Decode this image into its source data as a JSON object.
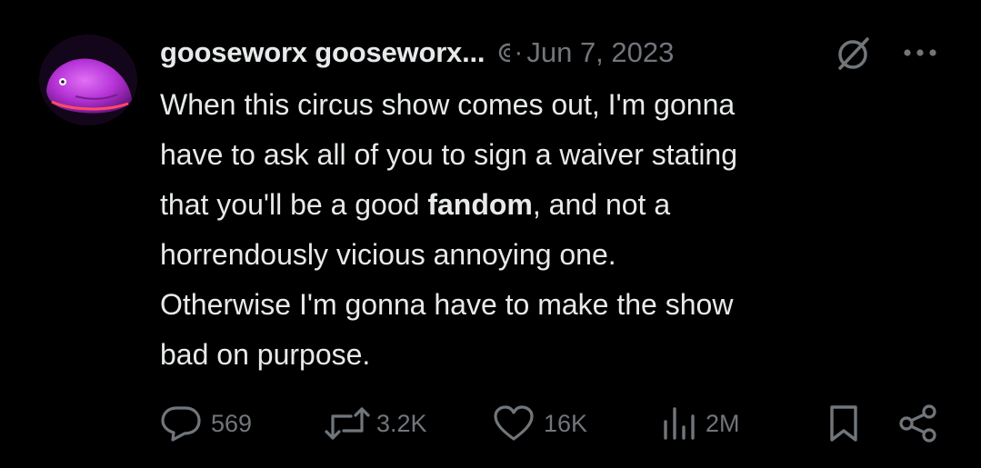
{
  "tweet": {
    "display_name": "gooseworx gooseworx...",
    "separator": "·",
    "date": "Jun 7, 2023",
    "body": {
      "line1": "When this circus show comes out, I'm gonna",
      "line2": "have to ask all of you to sign a waiver stating",
      "line3_before": "that you'll be a good ",
      "line3_bold": "fandom",
      "line3_after": ", and not a",
      "line4": "horrendously vicious annoying one.",
      "line5": "Otherwise I'm gonna have to make the show",
      "line6": "bad on purpose."
    }
  },
  "actions": {
    "replies": "569",
    "reposts": "3.2K",
    "likes": "16K",
    "views": "2M"
  },
  "icons": {
    "avatar": "purple-creature-avatar",
    "handle": "partial-badge-icon",
    "grok": "grok-icon",
    "more": "more-dots-icon",
    "reply": "reply-bubble-icon",
    "repost": "repost-arrows-icon",
    "like": "heart-icon",
    "views": "views-bar-chart-icon",
    "bookmark": "bookmark-icon",
    "share": "share-icon"
  },
  "colors": {
    "background": "#000000",
    "text": "#e7e9ea",
    "secondary": "#71767b",
    "avatar_accent": "#c03de0"
  }
}
